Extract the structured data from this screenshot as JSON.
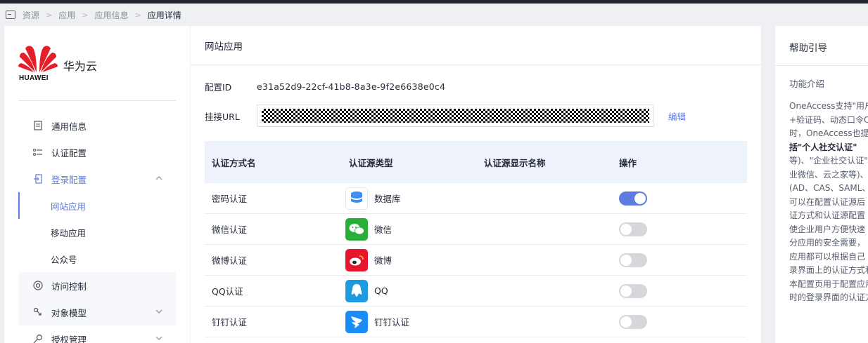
{
  "breadcrumb": {
    "items": [
      "资源",
      "应用",
      "应用信息"
    ],
    "current": "应用详情"
  },
  "sidebar": {
    "brand": "华为云",
    "logo_text": "HUAWEI",
    "menu": [
      {
        "label": "通用信息",
        "icon": "document-icon"
      },
      {
        "label": "认证配置",
        "icon": "settings-list-icon"
      },
      {
        "label": "登录配置",
        "icon": "login-icon"
      },
      {
        "label": "访问控制",
        "icon": "target-icon"
      },
      {
        "label": "对象模型",
        "icon": "model-icon"
      },
      {
        "label": "授权管理",
        "icon": "key-icon"
      }
    ],
    "submenu": [
      "网站应用",
      "移动应用",
      "公众号"
    ]
  },
  "main": {
    "title": "网站应用",
    "config_id_label": "配置ID",
    "config_id_value": "e31a52d9-22cf-41b8-8a3e-9f2e6638e0c4",
    "url_label": "挂接URL",
    "edit_label": "编辑",
    "table": {
      "headers": [
        "认证方式名",
        "认证源类型",
        "认证源显示名称",
        "操作"
      ],
      "rows": [
        {
          "name": "密码认证",
          "source": "数据库",
          "icon": "database-icon",
          "color": "#ffffff",
          "enabled": true
        },
        {
          "name": "微信认证",
          "source": "微信",
          "icon": "wechat-icon",
          "color": "#2aae3a",
          "enabled": false
        },
        {
          "name": "微博认证",
          "source": "微博",
          "icon": "weibo-icon",
          "color": "#e6162d",
          "enabled": false
        },
        {
          "name": "QQ认证",
          "source": "QQ",
          "icon": "qq-icon",
          "color": "#1e9ae0",
          "enabled": false
        },
        {
          "name": "钉钉认证",
          "source": "钉钉认证",
          "icon": "dingtalk-icon",
          "color": "#1a8cf5",
          "enabled": false
        }
      ]
    }
  },
  "help": {
    "title": "帮助引导",
    "subtitle": "功能介绍",
    "lines": [
      "OneAccess支持\"用户",
      "+验证码、动态口令O",
      "时，OneAccess也提",
      "括\"个人社交认证\"",
      "等)、\"企业社交认证\"",
      "业微信、云之家等)、",
      "(AD、CAS、SAML、",
      "可以在配置认证源后",
      "证方式和认证源配置",
      "使企业用户方便快速",
      "分应用的安全需要，",
      "应用都可以根据自己",
      "录界面上的认证方式和",
      "本配置页用于配置应用",
      "时的登录界面的认证方"
    ]
  },
  "colors": {
    "accent": "#5e7ce0",
    "toggle_off": "#d5d7da"
  }
}
